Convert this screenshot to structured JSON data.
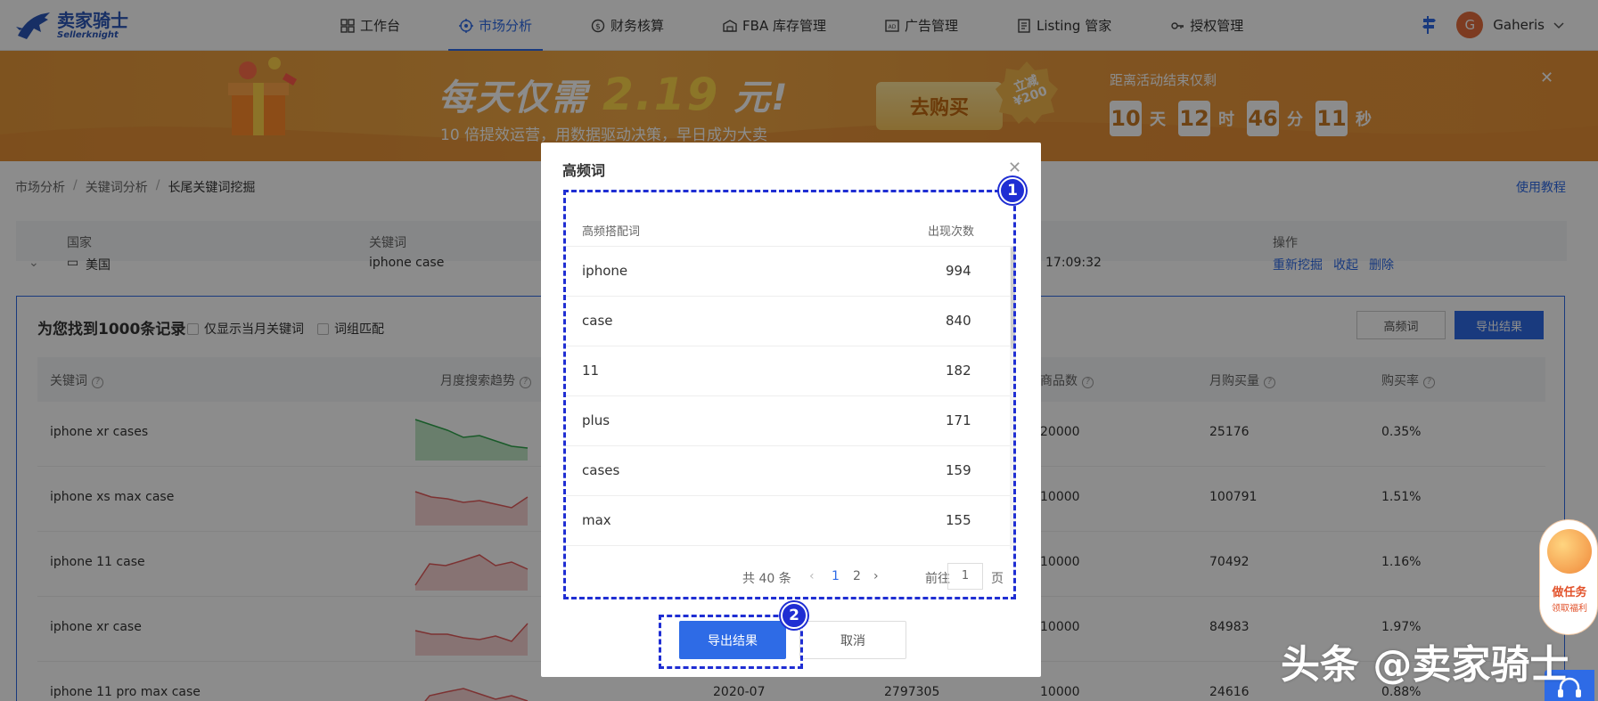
{
  "logo": {
    "cn": "卖家骑士",
    "en": "Sellerknight"
  },
  "nav": [
    {
      "label": "工作台",
      "icon": "grid-icon"
    },
    {
      "label": "市场分析",
      "icon": "target-icon"
    },
    {
      "label": "财务核算",
      "icon": "dollar-icon"
    },
    {
      "label": "FBA 库存管理",
      "icon": "warehouse-icon"
    },
    {
      "label": "广告管理",
      "icon": "ad-icon"
    },
    {
      "label": "Listing 管家",
      "icon": "doc-icon"
    },
    {
      "label": "授权管理",
      "icon": "key-icon"
    }
  ],
  "user": {
    "initial": "G",
    "name": "Gaheris"
  },
  "banner": {
    "headline_a": "每天仅需",
    "price": "2.19",
    "headline_b": "元!",
    "sub": "10 倍提效运营，用数据驱动决策，早日成为大卖",
    "buy": "去购买",
    "badge": "立减 ¥200",
    "countdown_label": "距离活动结束仅剩",
    "countdown": [
      {
        "num": "10",
        "unit": "天"
      },
      {
        "num": "12",
        "unit": "时"
      },
      {
        "num": "46",
        "unit": "分"
      },
      {
        "num": "11",
        "unit": "秒"
      }
    ]
  },
  "breadcrumb": {
    "a": "市场分析",
    "b": "关键词分析",
    "c": "长尾关键词挖掘",
    "tutorial": "使用教程"
  },
  "task_table": {
    "headers": {
      "country": "国家",
      "keyword": "关键词",
      "action": "操作"
    },
    "row": {
      "country": "美国",
      "keyword": "iphone case",
      "time": "17:09:32",
      "a1": "重新挖掘",
      "a2": "收起",
      "a3": "删除"
    }
  },
  "results": {
    "title": "为您找到1000条记录",
    "opt1": "仅显示当月关键词",
    "opt2": "词组匹配",
    "btn_hf": "高频词",
    "btn_export": "导出结果",
    "headers": {
      "kw": "关键词",
      "trend": "月度搜索趋势",
      "goods": "商品数",
      "buy": "月购买量",
      "rate": "购买率"
    },
    "rows": [
      {
        "kw": "iphone xr cases",
        "goods": "20000",
        "buy": "25176",
        "rate": "0.35%"
      },
      {
        "kw": "iphone xs max case",
        "goods": "10000",
        "buy": "100791",
        "rate": "1.51%"
      },
      {
        "kw": "iphone 11 case",
        "goods": "10000",
        "buy": "70492",
        "rate": "1.16%"
      },
      {
        "kw": "iphone xr case",
        "goods": "10000",
        "buy": "84983",
        "rate": "1.97%"
      },
      {
        "kw": "iphone 11 pro max case",
        "date": "2020-07",
        "search": "2797305",
        "goods": "10000",
        "buy": "24616",
        "rate": "0.88%"
      }
    ]
  },
  "modal": {
    "title": "高频词",
    "col_word": "高频搭配词",
    "col_count": "出现次数",
    "rows": [
      {
        "word": "iphone",
        "count": "994"
      },
      {
        "word": "case",
        "count": "840"
      },
      {
        "word": "11",
        "count": "182"
      },
      {
        "word": "plus",
        "count": "171"
      },
      {
        "word": "cases",
        "count": "159"
      },
      {
        "word": "max",
        "count": "155"
      }
    ],
    "pager": {
      "total": "共 40 条",
      "p1": "1",
      "p2": "2",
      "goto": "前往",
      "page_val": "1",
      "page_unit": "页"
    },
    "export": "导出结果",
    "cancel": "取消"
  },
  "annotations": {
    "one": "1",
    "two": "2"
  },
  "float": {
    "task": "做任务",
    "task_sub": "领取福利"
  },
  "watermark": "头条 @卖家骑士",
  "colors": {
    "primary": "#2e6be6",
    "annotation": "#1f2ed3",
    "banner": "#f0a845"
  }
}
